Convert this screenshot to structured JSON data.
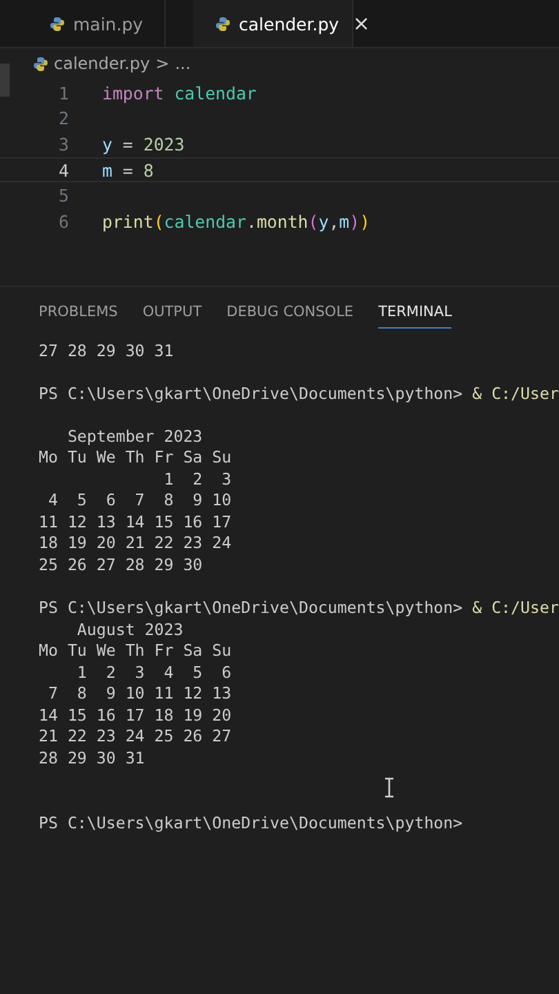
{
  "tabs": [
    {
      "label": "main.py",
      "selected": false
    },
    {
      "label": "calender.py",
      "selected": true,
      "close": "×"
    }
  ],
  "breadcrumb": {
    "file": "calender.py",
    "separator": ">",
    "rest": "..."
  },
  "code_lines": [
    {
      "number": "1",
      "current": false,
      "tokens": [
        {
          "text": "import ",
          "kind": "keyword"
        },
        {
          "text": "calendar",
          "kind": "module"
        }
      ]
    },
    {
      "number": "2",
      "current": false
    },
    {
      "number": "3",
      "current": false,
      "tokens": [
        {
          "text": "y",
          "kind": "variable"
        },
        {
          "text": " = ",
          "kind": "plain"
        },
        {
          "text": "2023",
          "kind": "number"
        }
      ]
    },
    {
      "number": "4",
      "current": true,
      "tokens": [
        {
          "text": "m",
          "kind": "variable"
        },
        {
          "text": " = ",
          "kind": "plain"
        },
        {
          "text": "8",
          "kind": "number"
        }
      ]
    },
    {
      "number": "5",
      "current": false
    },
    {
      "number": "6",
      "current": false,
      "tokens": [
        {
          "text": "print",
          "kind": "function"
        },
        {
          "text": "(",
          "kind": "bracket1"
        },
        {
          "text": "calendar",
          "kind": "module"
        },
        {
          "text": ".",
          "kind": "plain"
        },
        {
          "text": "month",
          "kind": "function"
        },
        {
          "text": "(",
          "kind": "bracket2"
        },
        {
          "text": "y",
          "kind": "variable"
        },
        {
          "text": ",",
          "kind": "plain"
        },
        {
          "text": "m",
          "kind": "variable"
        },
        {
          "text": ")",
          "kind": "bracket2"
        },
        {
          "text": ")",
          "kind": "bracket1"
        }
      ]
    }
  ],
  "panel_tabs": [
    {
      "label": "PROBLEMS",
      "selected": false
    },
    {
      "label": "OUTPUT",
      "selected": false
    },
    {
      "label": "DEBUG CONSOLE",
      "selected": false
    },
    {
      "label": "TERMINAL",
      "selected": true
    }
  ],
  "terminal_blocks": [
    [
      {
        "text": "27 28 29 30 31"
      }
    ],
    [
      {
        "text": "PS C:\\Users\\gkart\\OneDrive\\Documents\\python> ",
        "command": "& C:/User"
      }
    ],
    [
      {
        "text": "   September 2023"
      },
      {
        "text": "Mo Tu We Th Fr Sa Su"
      },
      {
        "text": "             1  2  3"
      },
      {
        "text": " 4  5  6  7  8  9 10"
      },
      {
        "text": "11 12 13 14 15 16 17"
      },
      {
        "text": "18 19 20 21 22 23 24"
      },
      {
        "text": "25 26 27 28 29 30"
      }
    ],
    [
      {
        "text": "PS C:\\Users\\gkart\\OneDrive\\Documents\\python> ",
        "command": "& C:/User"
      },
      {
        "text": "    August 2023"
      },
      {
        "text": "Mo Tu We Th Fr Sa Su"
      },
      {
        "text": "    1  2  3  4  5  6"
      },
      {
        "text": " 7  8  9 10 11 12 13"
      },
      {
        "text": "14 15 16 17 18 19 20"
      },
      {
        "text": "21 22 23 24 25 26 27"
      },
      {
        "text": "28 29 30 31"
      }
    ],
    [
      {
        "text": "PS C:\\Users\\gkart\\OneDrive\\Documents\\python>"
      }
    ]
  ]
}
